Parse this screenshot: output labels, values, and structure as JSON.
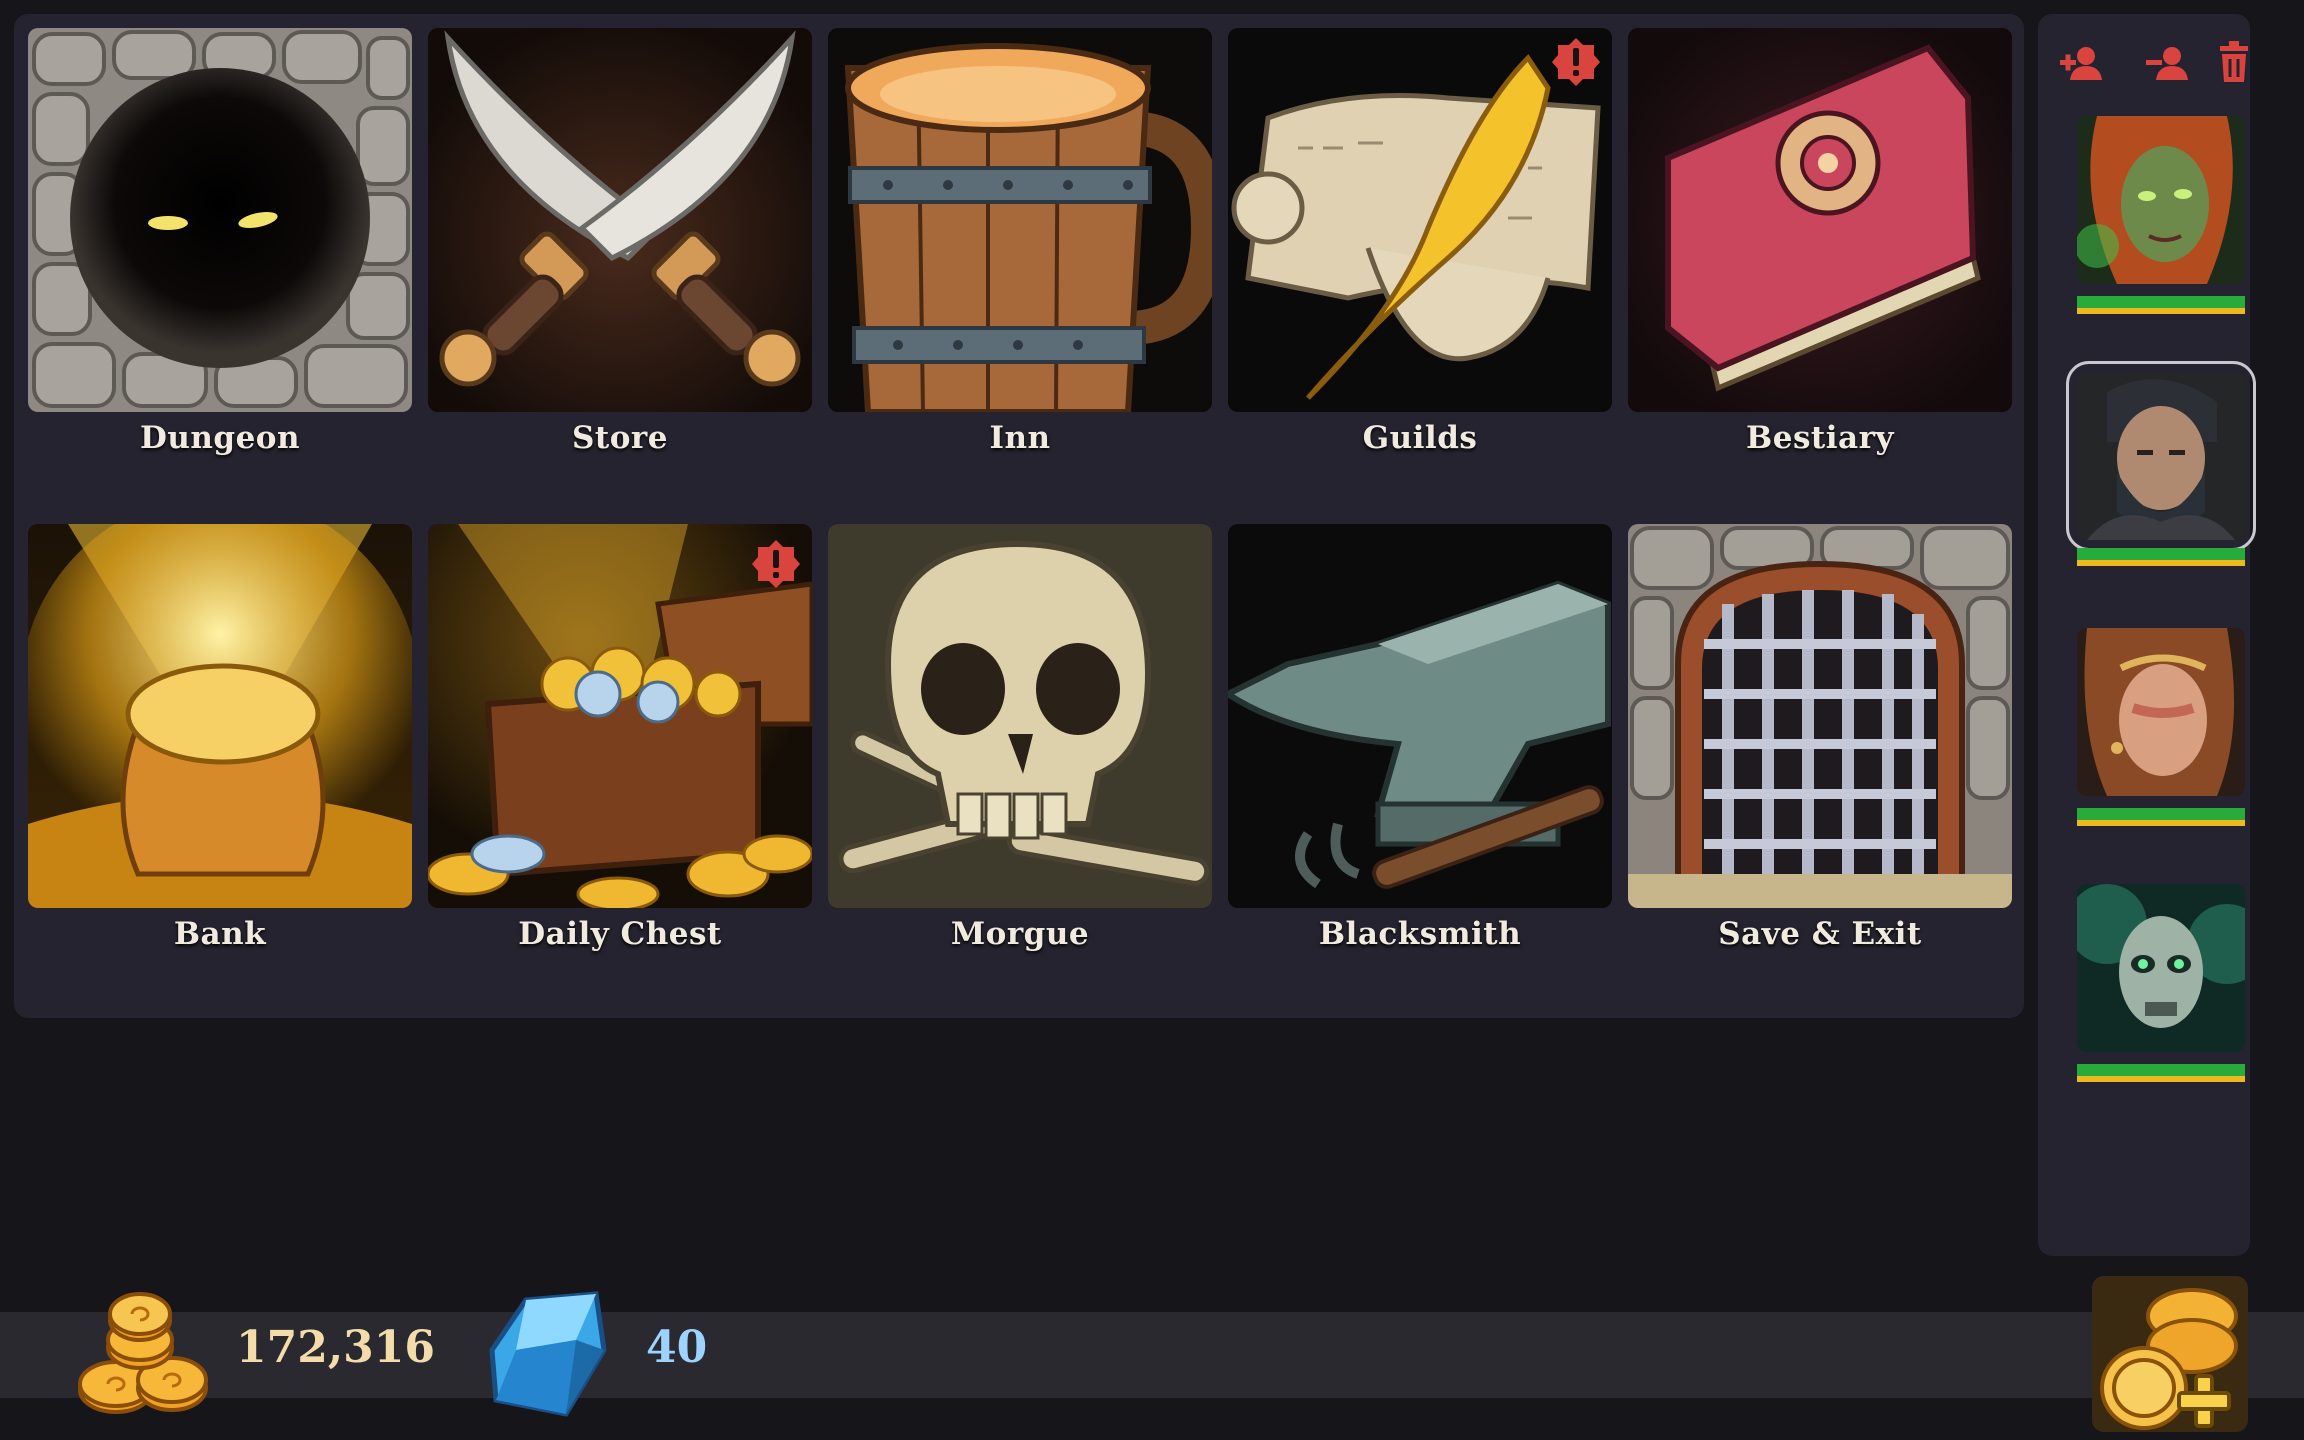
{
  "locations": [
    {
      "id": "dungeon",
      "label": "Dungeon",
      "icon": "dungeon-cave-icon",
      "alert": false
    },
    {
      "id": "store",
      "label": "Store",
      "icon": "crossed-daggers-icon",
      "alert": false
    },
    {
      "id": "inn",
      "label": "Inn",
      "icon": "tankard-icon",
      "alert": false
    },
    {
      "id": "guilds",
      "label": "Guilds",
      "icon": "scroll-quill-icon",
      "alert": true
    },
    {
      "id": "bestiary",
      "label": "Bestiary",
      "icon": "book-icon",
      "alert": false
    },
    {
      "id": "bank",
      "label": "Bank",
      "icon": "gold-sack-icon",
      "alert": false
    },
    {
      "id": "daily_chest",
      "label": "Daily Chest",
      "icon": "treasure-chest-icon",
      "alert": true
    },
    {
      "id": "morgue",
      "label": "Morgue",
      "icon": "skull-icon",
      "alert": false
    },
    {
      "id": "blacksmith",
      "label": "Blacksmith",
      "icon": "anvil-icon",
      "alert": false
    },
    {
      "id": "save_exit",
      "label": "Save & Exit",
      "icon": "portcullis-icon",
      "alert": false
    }
  ],
  "party": {
    "actions": [
      {
        "name": "add-hero-icon"
      },
      {
        "name": "remove-hero-icon"
      },
      {
        "name": "delete-icon"
      }
    ],
    "heroes": [
      {
        "name": "hero-portrait-1",
        "hp": 1.0,
        "mp": 1.0,
        "selected": false
      },
      {
        "name": "hero-portrait-2",
        "hp": 1.0,
        "mp": 1.0,
        "selected": true
      },
      {
        "name": "hero-portrait-3",
        "hp": 1.0,
        "mp": 1.0,
        "selected": false
      },
      {
        "name": "hero-portrait-4",
        "hp": 1.0,
        "mp": 1.0,
        "selected": false
      }
    ]
  },
  "resources": {
    "gold": "172,316",
    "gems": "40"
  },
  "colors": {
    "accent_red": "#d9443f",
    "hp_green": "#27ac3c",
    "mp_gold": "#eeb821"
  }
}
